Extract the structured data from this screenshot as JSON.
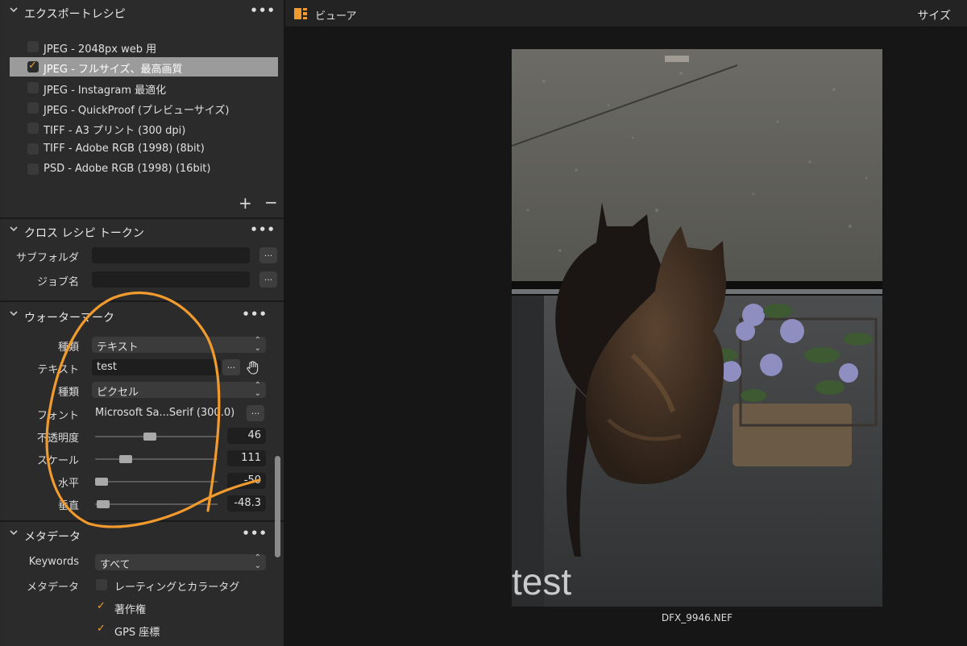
{
  "export_recipes": {
    "title": "エクスポートレシピ",
    "items": [
      {
        "label": "JPEG - 2048px web 用",
        "checked": false
      },
      {
        "label": "JPEG - フルサイズ、最高画質",
        "checked": true
      },
      {
        "label": "JPEG - Instagram 最適化",
        "checked": false
      },
      {
        "label": "JPEG - QuickProof (プレビューサイズ)",
        "checked": false
      },
      {
        "label": "TIFF - A3 プリント (300 dpi)",
        "checked": false
      },
      {
        "label": "TIFF - Adobe RGB (1998) (8bit)",
        "checked": false
      },
      {
        "label": "PSD - Adobe RGB (1998) (16bit)",
        "checked": false
      }
    ],
    "add_label": "+",
    "remove_label": "−"
  },
  "cross_recipe": {
    "title": "クロス レシピ トークン",
    "subfolder_label": "サブフォルダ",
    "jobname_label": "ジョブ名",
    "ellipsis": "..."
  },
  "watermark": {
    "title": "ウォーターマーク",
    "kind_label": "種類",
    "kind_value": "テキスト",
    "text_label": "テキスト",
    "text_value": "test",
    "unit_label": "種類",
    "unit_value": "ピクセル",
    "font_label": "フォント",
    "font_value": "Microsoft Sa...Serif (300.0)",
    "opacity_label": "不透明度",
    "opacity_value": "46",
    "scale_label": "スケール",
    "scale_value": "111",
    "horizontal_label": "水平",
    "horizontal_value": "-50",
    "vertical_label": "垂直",
    "vertical_value": "-48.3",
    "ellipsis": "..."
  },
  "metadata": {
    "title": "メタデータ",
    "keywords_label": "Keywords",
    "keywords_value": "すべて",
    "metadata_label": "メタデータ",
    "options": [
      {
        "label": "レーティングとカラータグ",
        "checked": false
      },
      {
        "label": "著作権",
        "checked": true
      },
      {
        "label": "GPS 座標",
        "checked": true
      }
    ]
  },
  "viewer": {
    "title": "ビューア",
    "size_label": "サイズ",
    "watermark_text": "test",
    "filename": "DFX_9946.NEF"
  },
  "colors": {
    "accent": "#f0a030",
    "annotation": "#f19a2e",
    "panel_bg": "#2b2b2b",
    "selected_row": "#9b9b9b"
  },
  "icons": {
    "collapse": "chevron-down-icon",
    "more": "more-dots-icon",
    "viewer": "viewer-layout-icon",
    "hand": "hand-drag-icon"
  }
}
